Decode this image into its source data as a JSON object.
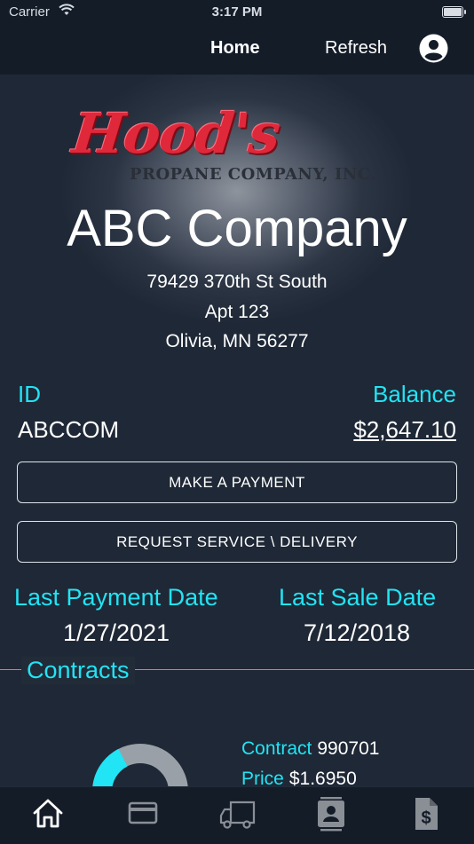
{
  "status_bar": {
    "carrier": "Carrier",
    "time": "3:17 PM"
  },
  "nav": {
    "home": "Home",
    "refresh": "Refresh",
    "account_icon": "account-circle-icon"
  },
  "logo": {
    "script": "Hood's",
    "subtitle": "PROPANE COMPANY, INC."
  },
  "account": {
    "name": "ABC Company",
    "address_line1": "79429 370th St South",
    "address_line2": "Apt 123",
    "address_line3": "Olivia, MN 56277",
    "id_label": "ID",
    "id_value": "ABCCOM",
    "balance_label": "Balance",
    "balance_value": "$2,647.10"
  },
  "buttons": {
    "make_payment": "MAKE A PAYMENT",
    "request_service": "REQUEST SERVICE \\ DELIVERY"
  },
  "dates": {
    "last_payment_label": "Last Payment Date",
    "last_payment_value": "1/27/2021",
    "last_sale_label": "Last Sale Date",
    "last_sale_value": "7/12/2018"
  },
  "contracts": {
    "title": "Contracts",
    "contract_label": "Contract",
    "contract_value": "990701",
    "price_label": "Price",
    "price_value": "$1.6950",
    "gauge_fraction": 0.35
  },
  "tab_bar": [
    "home-icon",
    "credit-card-icon",
    "delivery-truck-icon",
    "contact-card-icon",
    "invoice-dollar-icon"
  ],
  "colors": {
    "accent": "#21e4f4",
    "brand_red": "#e0283b",
    "background": "#1b2432",
    "bar": "#141c28"
  }
}
